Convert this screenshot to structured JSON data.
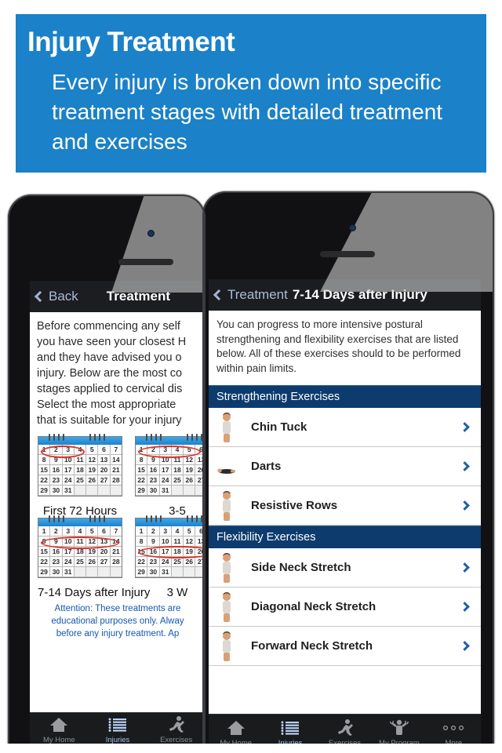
{
  "banner": {
    "title": "Injury Treatment",
    "subtitle": "Every injury is broken down into specific treatment stages with detailed treatment and exercises",
    "bg_color": "#1b81c8",
    "text_color": "#ffffff"
  },
  "left_phone": {
    "navbar": {
      "back_label": "Back",
      "back_icon": "chevron-left-icon",
      "title": "Treatment"
    },
    "intro_lines": [
      "Before commencing any self",
      "you have seen your closest H",
      "and they have advised you o",
      "injury. Below are the most co",
      "stages applied to cervical dis",
      "Select the most appropriate",
      "that is suitable for your injury"
    ],
    "stages": [
      {
        "caption": "First 72 Hours",
        "highlight_row": 0,
        "highlight_days": "1-3"
      },
      {
        "caption": "3-5",
        "highlight_row": 0,
        "highlight_days": "1-5"
      },
      {
        "caption": "7-14 Days after Injury",
        "highlight_row": 1,
        "highlight_days": "8-14"
      },
      {
        "caption": "3 W",
        "highlight_row": 2,
        "highlight_days": "15-21"
      }
    ],
    "calendar_days": [
      [
        "1",
        "2",
        "3",
        "4",
        "5",
        "6",
        "7"
      ],
      [
        "8",
        "9",
        "10",
        "11",
        "12",
        "13",
        "14"
      ],
      [
        "15",
        "16",
        "17",
        "18",
        "19",
        "20",
        "21"
      ],
      [
        "22",
        "23",
        "24",
        "25",
        "26",
        "27",
        "28"
      ],
      [
        "29",
        "30",
        "31",
        "",
        "",
        "",
        ""
      ]
    ],
    "attention_lines": [
      "Attention: These treatments are",
      "educational purposes only. Alway",
      "before any injury treatment. Ap"
    ],
    "tabs": [
      {
        "label": "My Home",
        "icon": "home-icon",
        "active": false
      },
      {
        "label": "Injuries",
        "icon": "list-icon",
        "active": true
      },
      {
        "label": "Exercises",
        "icon": "runner-icon",
        "active": false
      }
    ]
  },
  "right_phone": {
    "navbar": {
      "back_label": "Treatment",
      "back_icon": "chevron-left-icon",
      "title": "7-14 Days after Injury"
    },
    "description": "You can progress to more intensive postural strengthening and flexibility exercises that are listed below. All of these exercises should to be performed within pain limits.",
    "sections": [
      {
        "header": "Strengthening Exercises",
        "items": [
          {
            "label": "Chin Tuck",
            "thumb": "standing-side-posture-photo",
            "chevron": "chevron-right-icon"
          },
          {
            "label": "Darts",
            "thumb": "prone-lying-photo",
            "chevron": "chevron-right-icon"
          },
          {
            "label": "Resistive Rows",
            "thumb": "standing-rows-photo",
            "chevron": "chevron-right-icon"
          }
        ]
      },
      {
        "header": "Flexibility Exercises",
        "items": [
          {
            "label": "Side Neck Stretch",
            "thumb": "side-neck-stretch-photo",
            "chevron": "chevron-right-icon"
          },
          {
            "label": "Diagonal Neck Stretch",
            "thumb": "diagonal-neck-stretch-photo",
            "chevron": "chevron-right-icon"
          },
          {
            "label": "Forward Neck Stretch",
            "thumb": "forward-neck-stretch-photo",
            "chevron": "chevron-right-icon"
          }
        ]
      }
    ],
    "tabs": [
      {
        "label": "My Home",
        "icon": "home-icon",
        "active": false
      },
      {
        "label": "Injuries",
        "icon": "list-icon",
        "active": true
      },
      {
        "label": "Exercises",
        "icon": "runner-icon",
        "active": false
      },
      {
        "label": "My Program",
        "icon": "program-icon",
        "active": false
      },
      {
        "label": "More",
        "icon": "ellipsis-icon",
        "active": false
      }
    ]
  },
  "colors": {
    "banner_blue": "#1b81c8",
    "section_navy": "#0d3b6e",
    "nav_dark": "#1c1d20",
    "chevron_blue": "#1f5fa8",
    "attention_blue": "#1557b0",
    "calendar_red": "#d8352a"
  }
}
